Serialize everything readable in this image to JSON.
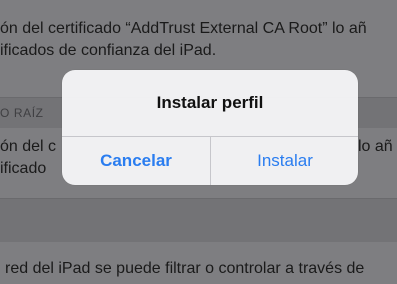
{
  "background": {
    "line1": "ón del certificado “AddTrust External CA Root” lo añ",
    "line2": "ificados de confianza del iPad.",
    "section_header": "O RAÍZ",
    "line3": "ón del c",
    "line3_right": "lo añ",
    "line4": "ificado",
    "line5": "red del iPad se puede filtrar o controlar a través de"
  },
  "alert": {
    "title": "Instalar perfil",
    "cancel_label": "Cancelar",
    "install_label": "Instalar"
  },
  "colors": {
    "accent": "#2a7df0",
    "dim_overlay": "#7a7a7d",
    "alert_bg": "#f4f4f6"
  }
}
